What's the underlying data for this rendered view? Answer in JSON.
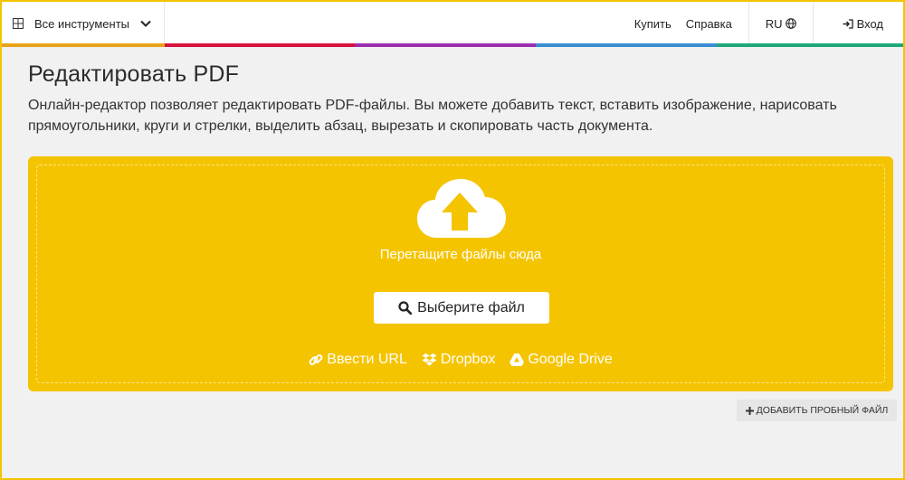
{
  "header": {
    "tools_label": "Все инструменты",
    "buy_label": "Купить",
    "help_label": "Справка",
    "lang_label": "RU",
    "login_label": "Вход"
  },
  "colorbar": [
    "#e8a317",
    "#d6123f",
    "#9b2fae",
    "#3b8fd1",
    "#1fa87a"
  ],
  "main": {
    "title": "Редактировать PDF",
    "description": "Онлайн-редактор позволяет редактировать PDF-файлы. Вы можете добавить текст, вставить изображение, нарисовать прямоугольники, круги и стрелки, выделить абзац, вырезать и скопировать часть документа."
  },
  "upload": {
    "drop_text": "Перетащите файлы сюда",
    "choose_label": "Выберите файл",
    "url_label": "Ввести URL",
    "dropbox_label": "Dropbox",
    "gdrive_label": "Google Drive"
  },
  "sample": {
    "label": "ДОБАВИТЬ ПРОБНЫЙ ФАЙЛ"
  },
  "colors": {
    "accent": "#f5c400",
    "background": "#f1f1f1"
  },
  "icons": [
    "grid-icon",
    "chevron-down-icon",
    "globe-icon",
    "login-icon",
    "cloud-upload-icon",
    "search-icon",
    "link-icon",
    "dropbox-icon",
    "google-drive-icon",
    "plus-icon"
  ]
}
